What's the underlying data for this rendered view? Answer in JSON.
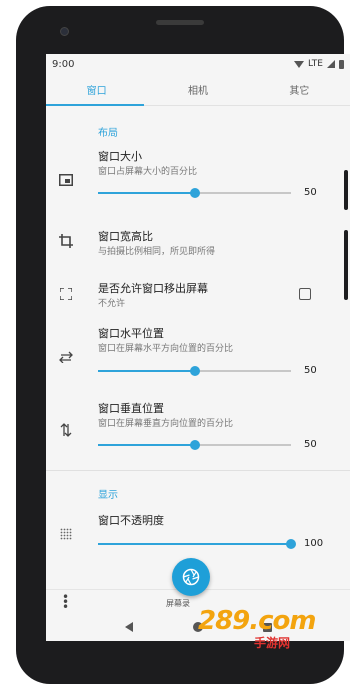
{
  "status_bar": {
    "time": "9:00",
    "network": "LTE"
  },
  "tabs": [
    {
      "label": "窗口",
      "active": true
    },
    {
      "label": "相机",
      "active": false
    },
    {
      "label": "其它",
      "active": false
    }
  ],
  "sections": {
    "layout": "布局",
    "display": "显示"
  },
  "settings": {
    "window_size": {
      "title": "窗口大小",
      "subtitle": "窗口占屏幕大小的百分比",
      "value": "50",
      "fraction": 0.5,
      "icon": "picture-in-picture-icon"
    },
    "aspect_ratio": {
      "title": "窗口宽高比",
      "subtitle": "与拍摄比例相同，所见即所得",
      "icon": "crop-icon"
    },
    "allow_offscreen": {
      "title": "是否允许窗口移出屏幕",
      "subtitle": "不允许",
      "checked": false,
      "icon": "fullscreen-icon"
    },
    "horizontal_pos": {
      "title": "窗口水平位置",
      "subtitle": "窗口在屏幕水平方向位置的百分比",
      "value": "50",
      "fraction": 0.5,
      "icon": "swap-horizontal-icon"
    },
    "vertical_pos": {
      "title": "窗口垂直位置",
      "subtitle": "窗口在屏幕垂直方向位置的百分比",
      "value": "50",
      "fraction": 0.5,
      "icon": "swap-vertical-icon"
    },
    "opacity": {
      "title": "窗口不透明度",
      "value": "100",
      "fraction": 1.0,
      "icon": "opacity-dots-icon"
    }
  },
  "bottom": {
    "fab_label": "屏幕录",
    "fab_icon": "shutter-icon",
    "overflow_icon": "more-vert-icon"
  },
  "watermark": {
    "main": "289.com",
    "sub": "手游网"
  },
  "colors": {
    "accent": "#2ea3da",
    "background": "#f5f5f5",
    "watermark_orange": "#f3a40f",
    "watermark_red": "#e0322f"
  }
}
